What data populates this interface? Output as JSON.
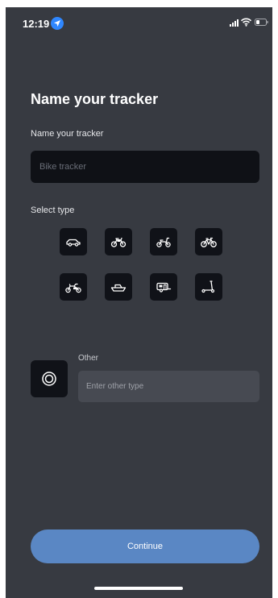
{
  "status_bar": {
    "time": "12:19",
    "icons": [
      "location-arrow-icon",
      "signal-icon",
      "wifi-icon",
      "battery-icon"
    ]
  },
  "page": {
    "title": "Name your tracker"
  },
  "name_field": {
    "label": "Name your tracker",
    "value": "",
    "placeholder": "Bike tracker"
  },
  "type_section": {
    "label": "Select type",
    "types": [
      {
        "icon": "car-icon"
      },
      {
        "icon": "motorcycle-icon"
      },
      {
        "icon": "scooter-icon"
      },
      {
        "icon": "bicycle-icon"
      },
      {
        "icon": "cargo-bike-icon"
      },
      {
        "icon": "boat-icon"
      },
      {
        "icon": "caravan-icon"
      },
      {
        "icon": "kick-scooter-icon"
      }
    ]
  },
  "other": {
    "icon": "target-icon",
    "label": "Other",
    "value": "",
    "placeholder": "Enter other type"
  },
  "continue_button": {
    "label": "Continue"
  },
  "colors": {
    "background": "#373a41",
    "input_dark": "#0f1116",
    "tile": "#101218",
    "other_input": "#474a52",
    "primary_button": "#5a87c4",
    "location_blue": "#2f87ff"
  }
}
